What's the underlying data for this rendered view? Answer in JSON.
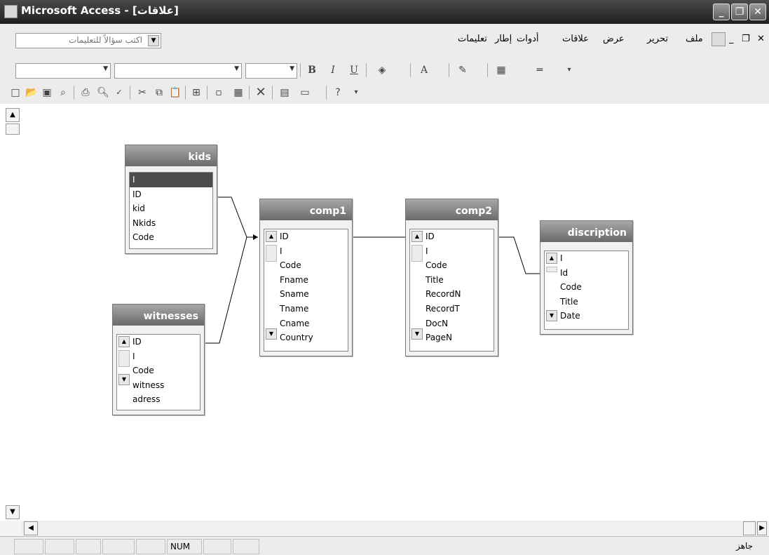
{
  "window": {
    "title": "Microsoft Access - [علاقات]"
  },
  "help_box": {
    "placeholder": "اكتب سؤالاً للتعليمات"
  },
  "menu": {
    "items": [
      "ملف",
      "تحرير",
      "عرض",
      "علاقات",
      "أدوات",
      "إطار",
      "تعليمات"
    ]
  },
  "format_toolbar": {
    "bold": "B",
    "italic": "I",
    "underline": "U"
  },
  "tables": [
    {
      "name": "kids",
      "fields": [
        "I",
        "ID",
        "kid",
        "Nkids",
        "Code"
      ],
      "selected": "I"
    },
    {
      "name": "comp1",
      "fields": [
        "ID",
        "I",
        "Code",
        "Fname",
        "Sname",
        "Tname",
        "Cname",
        "Country"
      ]
    },
    {
      "name": "comp2",
      "fields": [
        "ID",
        "I",
        "Code",
        "Title",
        "RecordN",
        "RecordT",
        "DocN",
        "PageN"
      ]
    },
    {
      "name": "discription",
      "fields": [
        "I",
        "Id",
        "Code",
        "Title",
        "Date"
      ]
    },
    {
      "name": "witnesses",
      "fields": [
        "ID",
        "I",
        "Code",
        "witness",
        "adress"
      ]
    }
  ],
  "status": {
    "num": "NUM",
    "ready": "جاهز"
  }
}
